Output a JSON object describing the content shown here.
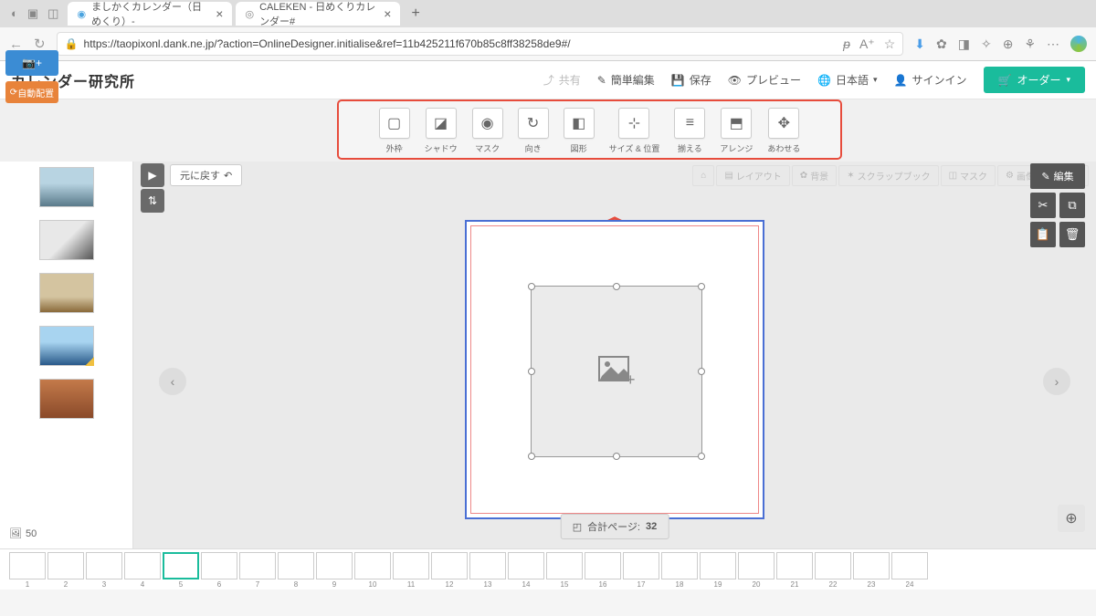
{
  "browser": {
    "tabs": [
      {
        "title": "ましかくカレンダー（日めくり）- "
      },
      {
        "title": "CALEKEN - 日めくりカレンダー#"
      }
    ],
    "url": "https://taopixonl.dank.ne.jp/?action=OnlineDesigner.initialise&ref=11b425211f670b85c8ff38258de9#/"
  },
  "app": {
    "logo": "カレンダー研究所",
    "toolbar": {
      "share": "共有",
      "easy_edit": "簡単編集",
      "save": "保存",
      "preview": "プレビュー",
      "language": "日本語",
      "signin": "サインイン",
      "order": "オーダー"
    }
  },
  "context_toolbar": [
    {
      "label": "外枠",
      "icon": "frame-icon"
    },
    {
      "label": "シャドウ",
      "icon": "shadow-icon"
    },
    {
      "label": "マスク",
      "icon": "mask-icon"
    },
    {
      "label": "向き",
      "icon": "rotate-icon"
    },
    {
      "label": "図形",
      "icon": "shape-icon"
    },
    {
      "label": "サイズ & 位置",
      "icon": "size-position-icon"
    },
    {
      "label": "揃える",
      "icon": "align-icon"
    },
    {
      "label": "アレンジ",
      "icon": "arrange-icon"
    },
    {
      "label": "あわせる",
      "icon": "fit-icon"
    }
  ],
  "left_sidebar": {
    "add_photo": "📷+",
    "auto_layout": "自動配置",
    "photo_count": "50"
  },
  "center": {
    "undo": "元に戻す",
    "hidden_tabs": [
      "レイアウト",
      "背景",
      "スクラップブック",
      "マスク",
      "画像オプション"
    ],
    "total_pages_label": "合計ページ:",
    "total_pages": "32"
  },
  "right_panel": {
    "edit": "編集"
  },
  "page_strip": {
    "pages": [
      "1",
      "2",
      "3",
      "4",
      "5",
      "6",
      "7",
      "8",
      "9",
      "10",
      "11",
      "12",
      "13",
      "14",
      "15",
      "16",
      "17",
      "18",
      "19",
      "20",
      "21",
      "22",
      "23",
      "24"
    ],
    "active": 5
  }
}
